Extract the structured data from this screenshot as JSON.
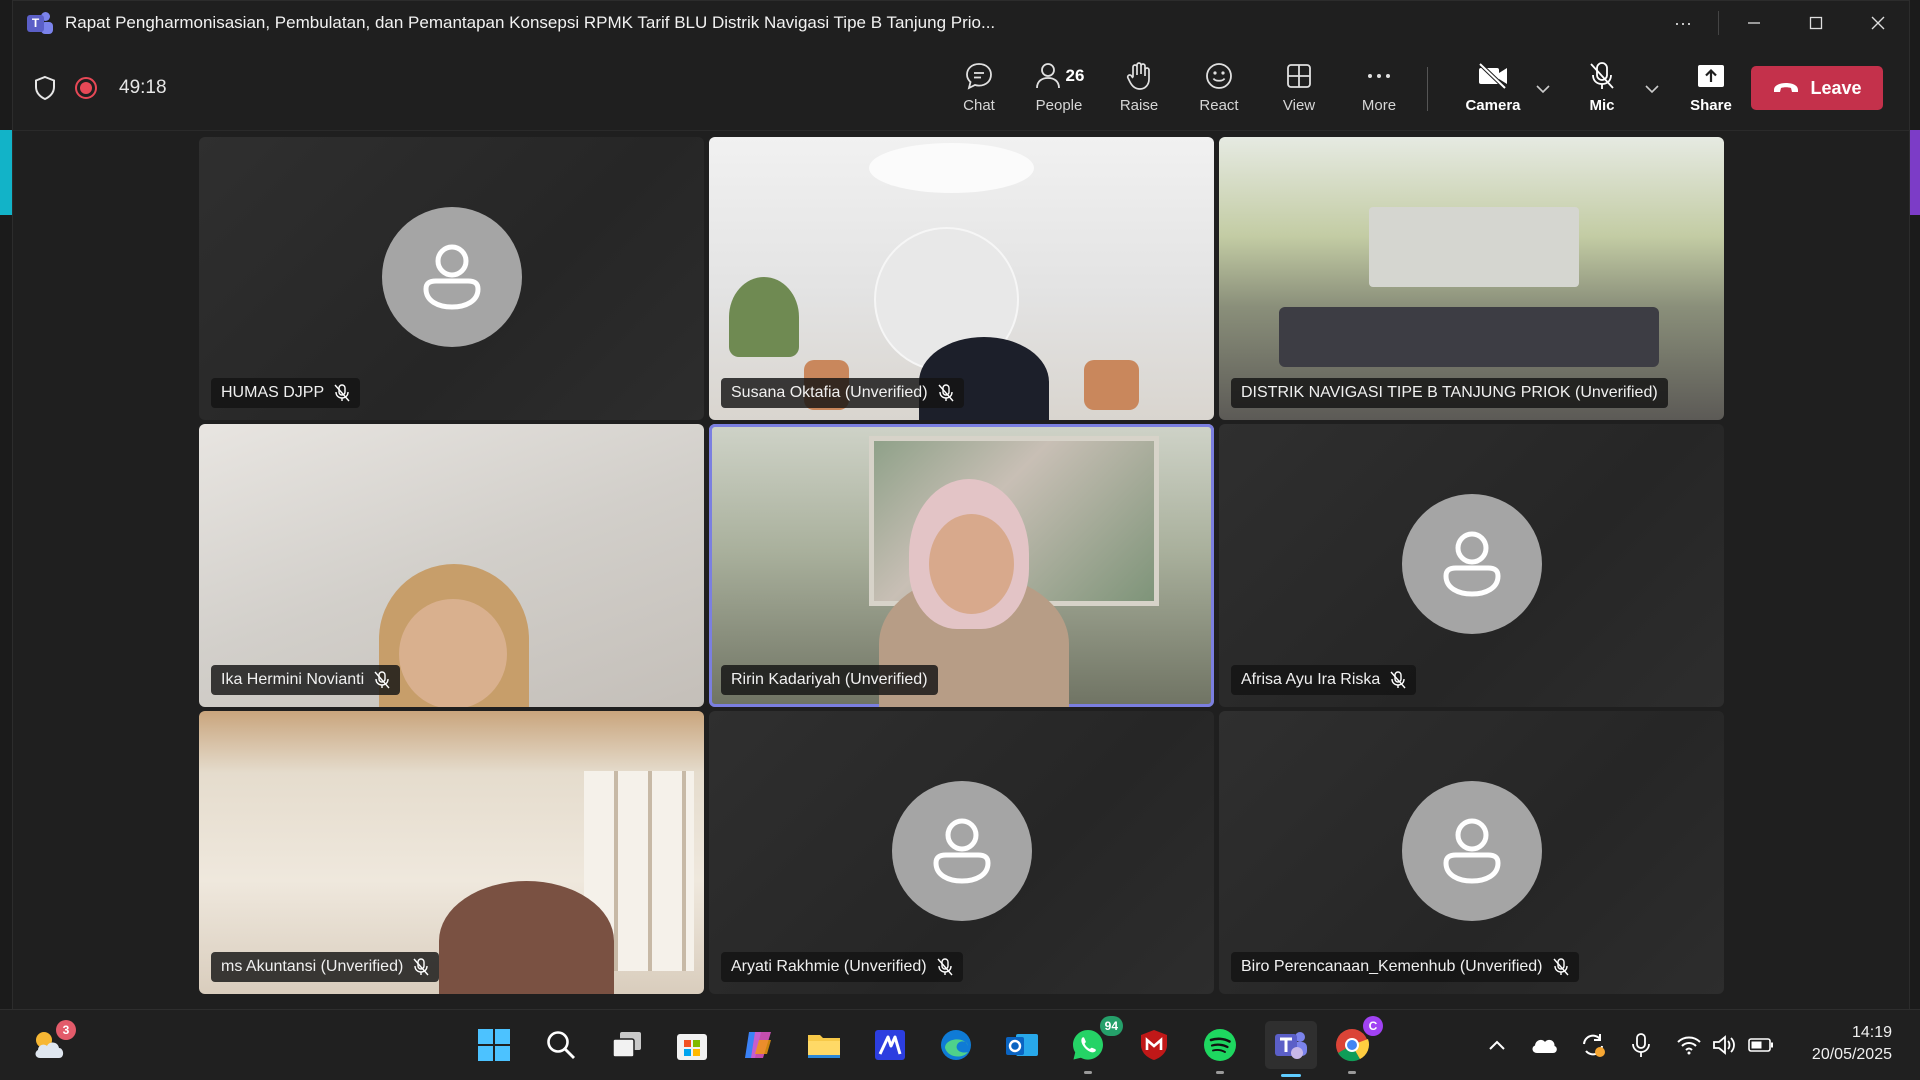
{
  "window": {
    "title": "Rapat Pengharmonisasian, Pembulatan, dan Pemantapan Konsepsi RPMK Tarif BLU Distrik Navigasi Tipe B Tanjung Prio...",
    "more_symbol": "···"
  },
  "toolbar": {
    "timer": "49:18",
    "chat": "Chat",
    "people": "People",
    "people_count": "26",
    "raise": "Raise",
    "react": "React",
    "view": "View",
    "more": "More",
    "camera": "Camera",
    "mic": "Mic",
    "share": "Share",
    "leave": "Leave"
  },
  "participants": [
    {
      "name": "HUMAS DJPP",
      "video": false
    },
    {
      "name": "Susana Oktafia (Unverified)",
      "video": true
    },
    {
      "name": "DISTRIK NAVIGASI TIPE B TANJUNG PRIOK (Unverified)",
      "video": true
    },
    {
      "name": "Ika Hermini Novianti",
      "video": true
    },
    {
      "name": "Ririn Kadariyah (Unverified)",
      "video": true,
      "speaking": true
    },
    {
      "name": "Afrisa Ayu Ira Riska",
      "video": false
    },
    {
      "name": "ms Akuntansi (Unverified)",
      "video": true
    },
    {
      "name": "Aryati Rakhmie (Unverified)",
      "video": false
    },
    {
      "name": "Biro Perencanaan_Kemenhub (Unverified)",
      "video": false
    }
  ],
  "taskbar": {
    "weather_badge": "3",
    "whatsapp_badge": "94",
    "chrome_badge": "C",
    "time": "14:19",
    "date": "20/05/2025"
  },
  "colors": {
    "leave": "#c4314b",
    "record": "#e74856",
    "active_speaker": "#7b7fe0",
    "teams": "#5b5fc7"
  }
}
